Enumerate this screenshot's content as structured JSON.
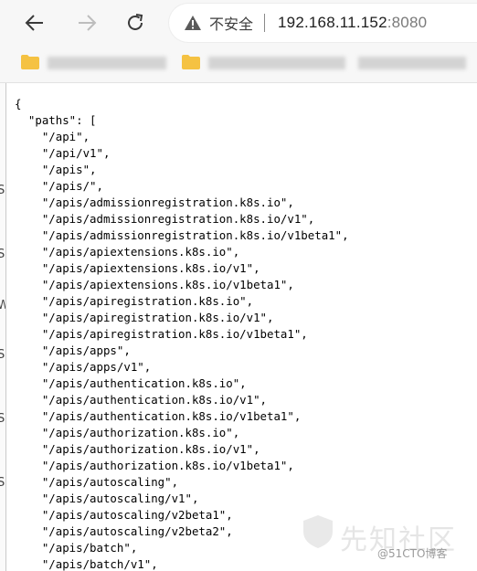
{
  "toolbar": {
    "back_icon": "arrow-left-icon",
    "forward_icon": "arrow-right-icon",
    "reload_icon": "reload-icon",
    "security_icon": "warning-triangle-icon",
    "security_label": "不安全",
    "url_host": "192.168.11.152",
    "url_port": ":8080"
  },
  "bookmarks": {
    "folder_icon": "folder-icon",
    "folder_color": "#f5c242"
  },
  "json_view": {
    "lines": [
      "{",
      "  \"paths\": [",
      "    \"/api\",",
      "    \"/api/v1\",",
      "    \"/apis\",",
      "    \"/apis/\",",
      "    \"/apis/admissionregistration.k8s.io\",",
      "    \"/apis/admissionregistration.k8s.io/v1\",",
      "    \"/apis/admissionregistration.k8s.io/v1beta1\",",
      "    \"/apis/apiextensions.k8s.io\",",
      "    \"/apis/apiextensions.k8s.io/v1\",",
      "    \"/apis/apiextensions.k8s.io/v1beta1\",",
      "    \"/apis/apiregistration.k8s.io\",",
      "    \"/apis/apiregistration.k8s.io/v1\",",
      "    \"/apis/apiregistration.k8s.io/v1beta1\",",
      "    \"/apis/apps\",",
      "    \"/apis/apps/v1\",",
      "    \"/apis/authentication.k8s.io\",",
      "    \"/apis/authentication.k8s.io/v1\",",
      "    \"/apis/authentication.k8s.io/v1beta1\",",
      "    \"/apis/authorization.k8s.io\",",
      "    \"/apis/authorization.k8s.io/v1\",",
      "    \"/apis/authorization.k8s.io/v1beta1\",",
      "    \"/apis/autoscaling\",",
      "    \"/apis/autoscaling/v1\",",
      "    \"/apis/autoscaling/v2beta1\",",
      "    \"/apis/autoscaling/v2beta2\",",
      "    \"/apis/batch\",",
      "    \"/apis/batch/v1\","
    ]
  },
  "watermark": {
    "text": "先知社区",
    "credit": "@51CTO博客"
  }
}
